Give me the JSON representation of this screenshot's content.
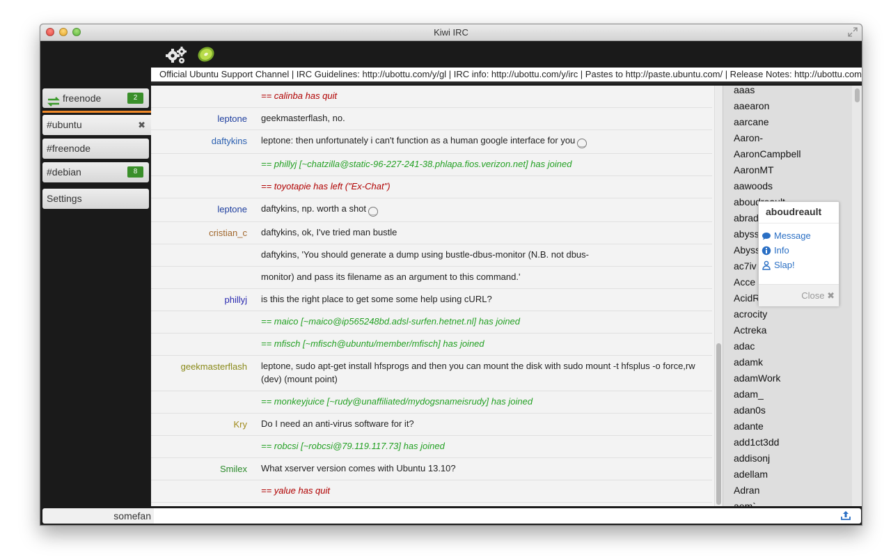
{
  "window": {
    "title": "Kiwi IRC"
  },
  "topic": "Official Ubuntu Support Channel | IRC Guidelines: http://ubottu.com/y/gl | IRC info: http://ubottu.com/y/irc | Pastes to http://paste.ubuntu.com/ | Release Notes: http://ubottu.com/y/",
  "sidebar": {
    "server": {
      "label": "freenode",
      "badge": "2"
    },
    "channels": [
      {
        "label": "#ubuntu",
        "close": "✖"
      },
      {
        "label": "#freenode"
      },
      {
        "label": "#debian",
        "badge": "8"
      }
    ],
    "settings_label": "Settings"
  },
  "messages": [
    {
      "nick": "",
      "text": "== calinba has quit",
      "kind": "quit"
    },
    {
      "nick": "leptone",
      "text": "geekmasterflash, no.",
      "kind": "msg",
      "nick_color": "#1f3f9f"
    },
    {
      "nick": "daftykins",
      "text": "leptone: then unfortunately i can't function as a human google interface for you",
      "kind": "msg",
      "nick_color": "#2a5fb0",
      "smiley": true
    },
    {
      "nick": "",
      "text": "== phillyj [~chatzilla@static-96-227-241-38.phlapa.fios.verizon.net] has joined",
      "kind": "join"
    },
    {
      "nick": "",
      "text": "== toyotapie has left (\"Ex-Chat\")",
      "kind": "quit"
    },
    {
      "nick": "leptone",
      "text": "daftykins, np. worth a shot",
      "kind": "msg",
      "nick_color": "#1f3f9f",
      "smiley": true
    },
    {
      "nick": "cristian_c",
      "text": "daftykins, ok, I've tried man bustle",
      "kind": "msg",
      "nick_color": "#a0652a"
    },
    {
      "nick": "",
      "text": "daftykins, 'You  should  generate  a dump using bustle-dbus-monitor (N.B. not dbus-",
      "kind": "msg"
    },
    {
      "nick": "",
      "text": "monitor) and pass its filename as an argument to this command.'",
      "kind": "msg"
    },
    {
      "nick": "phillyj",
      "text": "is this the right place to get some some help using cURL?",
      "kind": "msg",
      "nick_color": "#2a2ab0"
    },
    {
      "nick": "",
      "text": "== maico [~maico@ip565248bd.adsl-surfen.hetnet.nl] has joined",
      "kind": "join"
    },
    {
      "nick": "",
      "text": "== mfisch [~mfisch@ubuntu/member/mfisch] has joined",
      "kind": "join"
    },
    {
      "nick": "geekmasterflash",
      "text": "leptone, sudo apt-get install hfsprogs and then you can mount the disk with sudo mount -t hfsplus -o force,rw (dev) (mount point)",
      "kind": "msg",
      "nick_color": "#8a8a1a"
    },
    {
      "nick": "",
      "text": "== monkeyjuice [~rudy@unaffiliated/mydogsnameisrudy] has joined",
      "kind": "join"
    },
    {
      "nick": "Kry",
      "text": "Do I need an anti-virus software for it?",
      "kind": "msg",
      "nick_color": "#a08a1a"
    },
    {
      "nick": "",
      "text": "== robcsi [~robcsi@79.119.117.73] has joined",
      "kind": "join"
    },
    {
      "nick": "Smilex",
      "text": "What xserver version comes with Ubuntu 13.10?",
      "kind": "msg",
      "nick_color": "#2a8a2a"
    },
    {
      "nick": "",
      "text": "== yalue has quit",
      "kind": "quit"
    }
  ],
  "users": [
    "aaas",
    "aaearon",
    "aarcane",
    "Aaron-",
    "AaronCampbell",
    "AaronMT",
    "aawoods",
    "aboudreault",
    "abrad",
    "abyss",
    "Abyss",
    "ac7iv",
    "Acce",
    "AcidR",
    "acrocity",
    "Actreka",
    "adac",
    "adamk",
    "adamWork",
    "adam_",
    "adan0s",
    "adante",
    "add1ct3dd",
    "addisonj",
    "adellam",
    "Adran",
    "aem`"
  ],
  "popup": {
    "title": "aboudreault",
    "items": [
      "Message",
      "Info",
      "Slap!"
    ],
    "close": "Close ✖"
  },
  "bottom": {
    "nick": "somefan",
    "input_placeholder": ""
  },
  "colors": {
    "quit": "#b00000",
    "join": "#23a023",
    "badge": "#3a8f2a",
    "accent": "#f08a2a"
  }
}
